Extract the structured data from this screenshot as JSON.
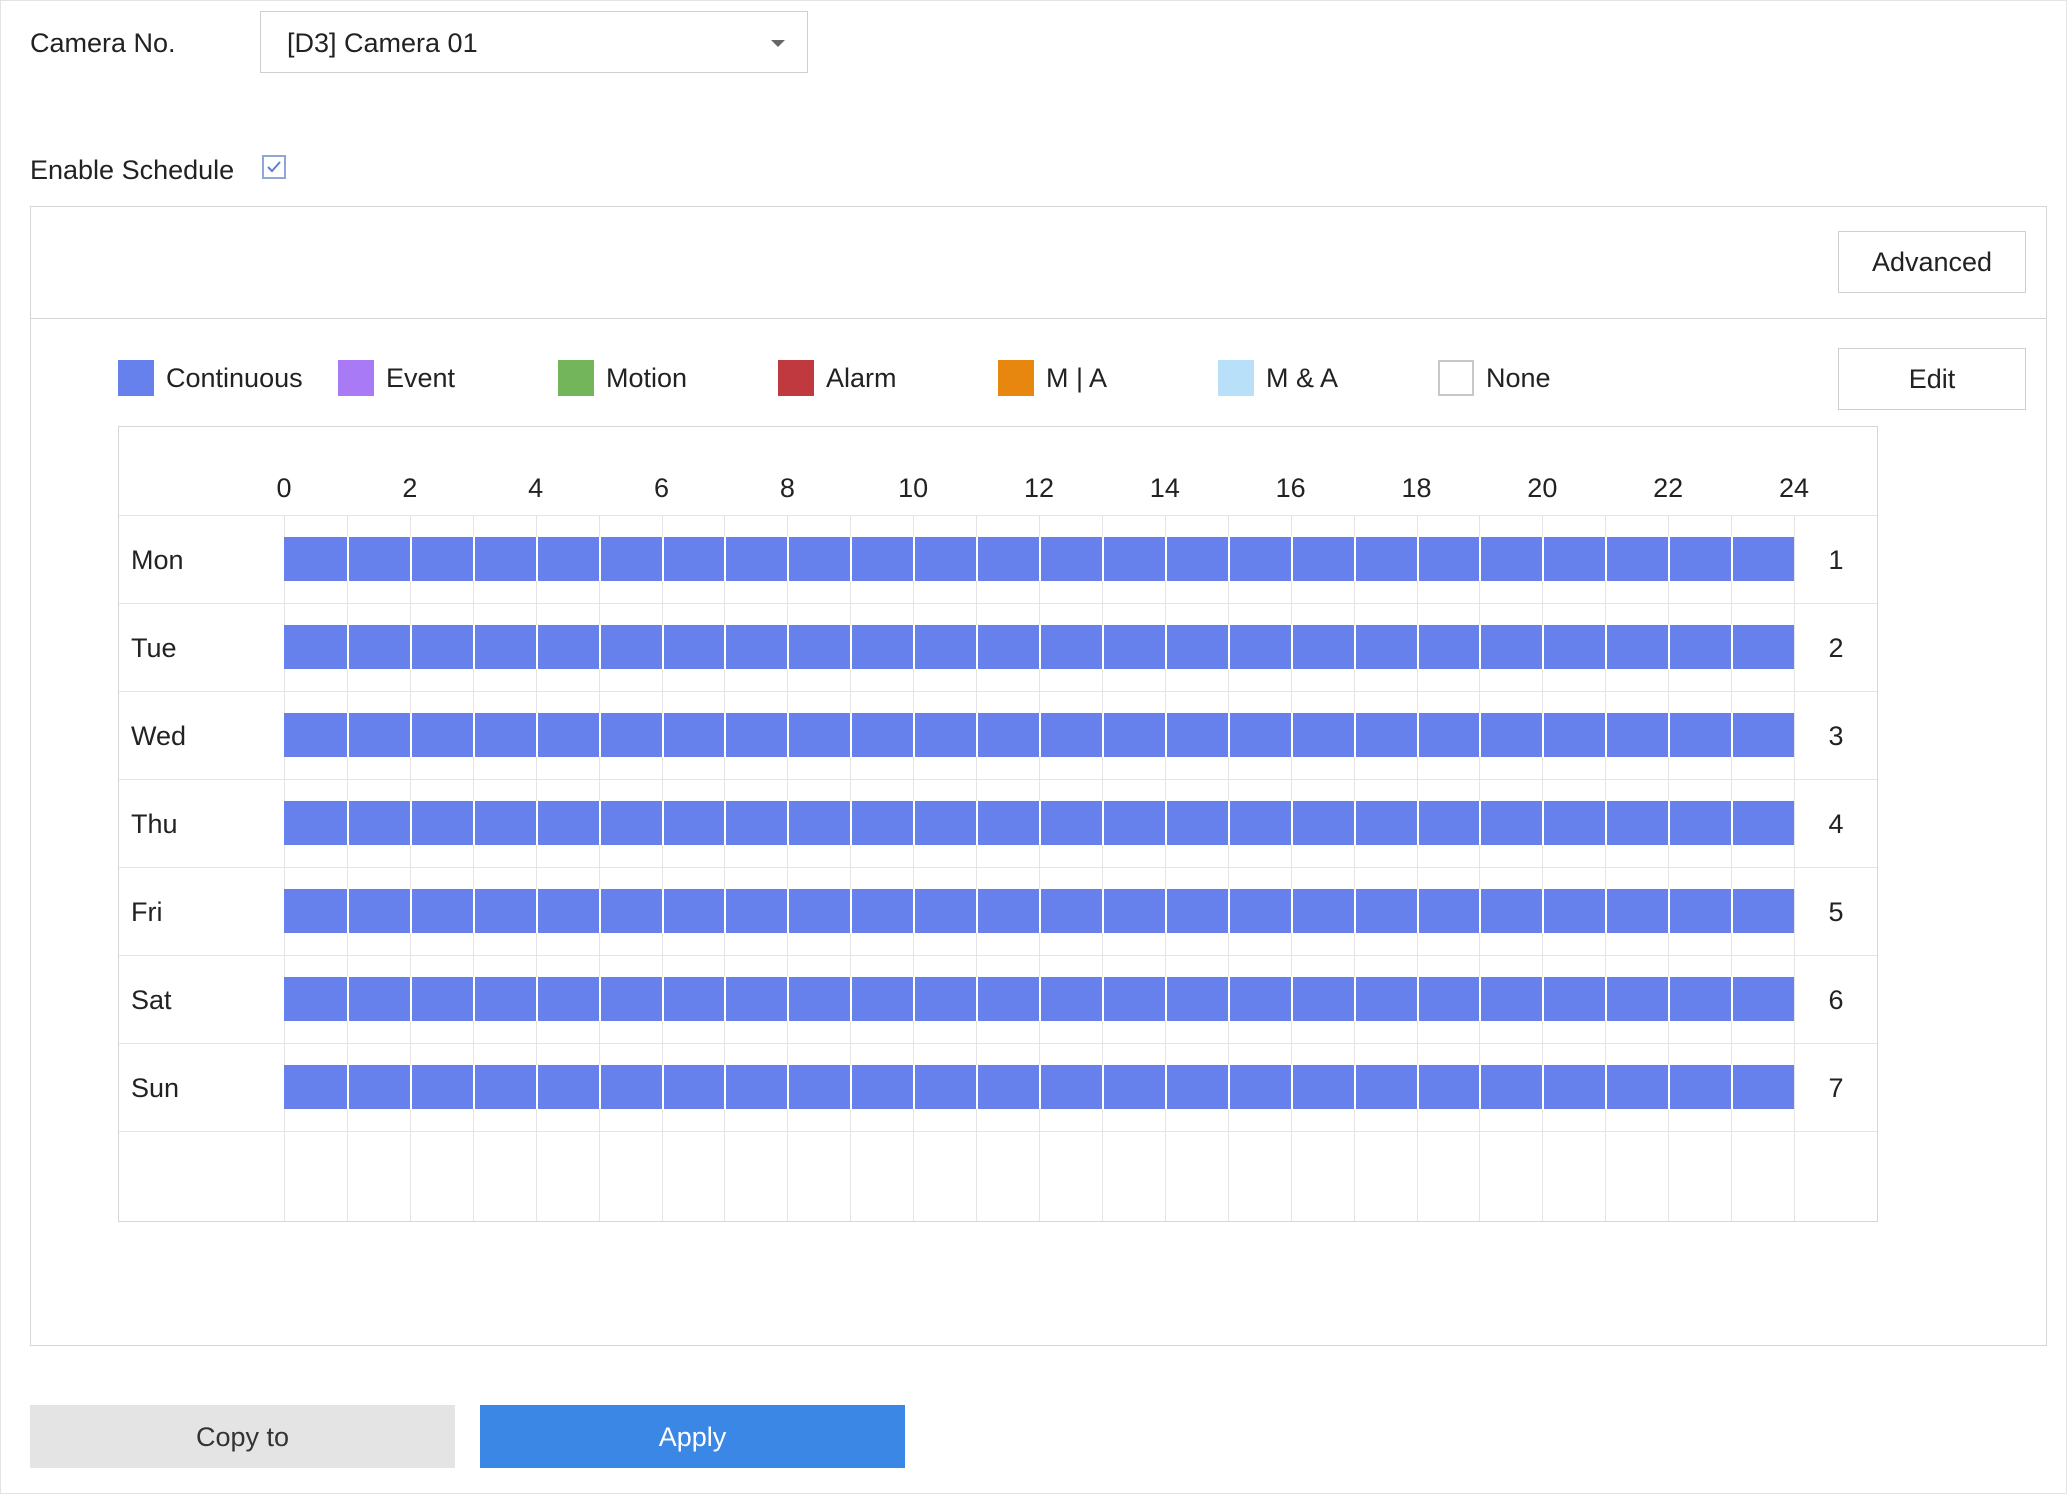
{
  "camera": {
    "label": "Camera No.",
    "selected": "[D3] Camera 01"
  },
  "schedule": {
    "enable_label": "Enable Schedule",
    "enabled": true
  },
  "buttons": {
    "advanced": "Advanced",
    "edit": "Edit",
    "copy_to": "Copy to",
    "apply": "Apply"
  },
  "legend": [
    {
      "label": "Continuous",
      "color": "#6680ec"
    },
    {
      "label": "Event",
      "color": "#a87af5"
    },
    {
      "label": "Motion",
      "color": "#72b55a"
    },
    {
      "label": "Alarm",
      "color": "#c0393f"
    },
    {
      "label": "M | A",
      "color": "#e8870f"
    },
    {
      "label": "M & A",
      "color": "#b8e0f8"
    },
    {
      "label": "None",
      "color": "#ffffff"
    }
  ],
  "grid": {
    "hour_ticks": [
      "0",
      "2",
      "4",
      "6",
      "8",
      "10",
      "12",
      "14",
      "16",
      "18",
      "20",
      "22",
      "24"
    ],
    "days": [
      {
        "name": "Mon",
        "number": "1",
        "start": 0,
        "end": 24,
        "type": "Continuous"
      },
      {
        "name": "Tue",
        "number": "2",
        "start": 0,
        "end": 24,
        "type": "Continuous"
      },
      {
        "name": "Wed",
        "number": "3",
        "start": 0,
        "end": 24,
        "type": "Continuous"
      },
      {
        "name": "Thu",
        "number": "4",
        "start": 0,
        "end": 24,
        "type": "Continuous"
      },
      {
        "name": "Fri",
        "number": "5",
        "start": 0,
        "end": 24,
        "type": "Continuous"
      },
      {
        "name": "Sat",
        "number": "6",
        "start": 0,
        "end": 24,
        "type": "Continuous"
      },
      {
        "name": "Sun",
        "number": "7",
        "start": 0,
        "end": 24,
        "type": "Continuous"
      }
    ]
  },
  "colors": {
    "accent": "#3a87e6",
    "continuous": "#6680ec"
  }
}
